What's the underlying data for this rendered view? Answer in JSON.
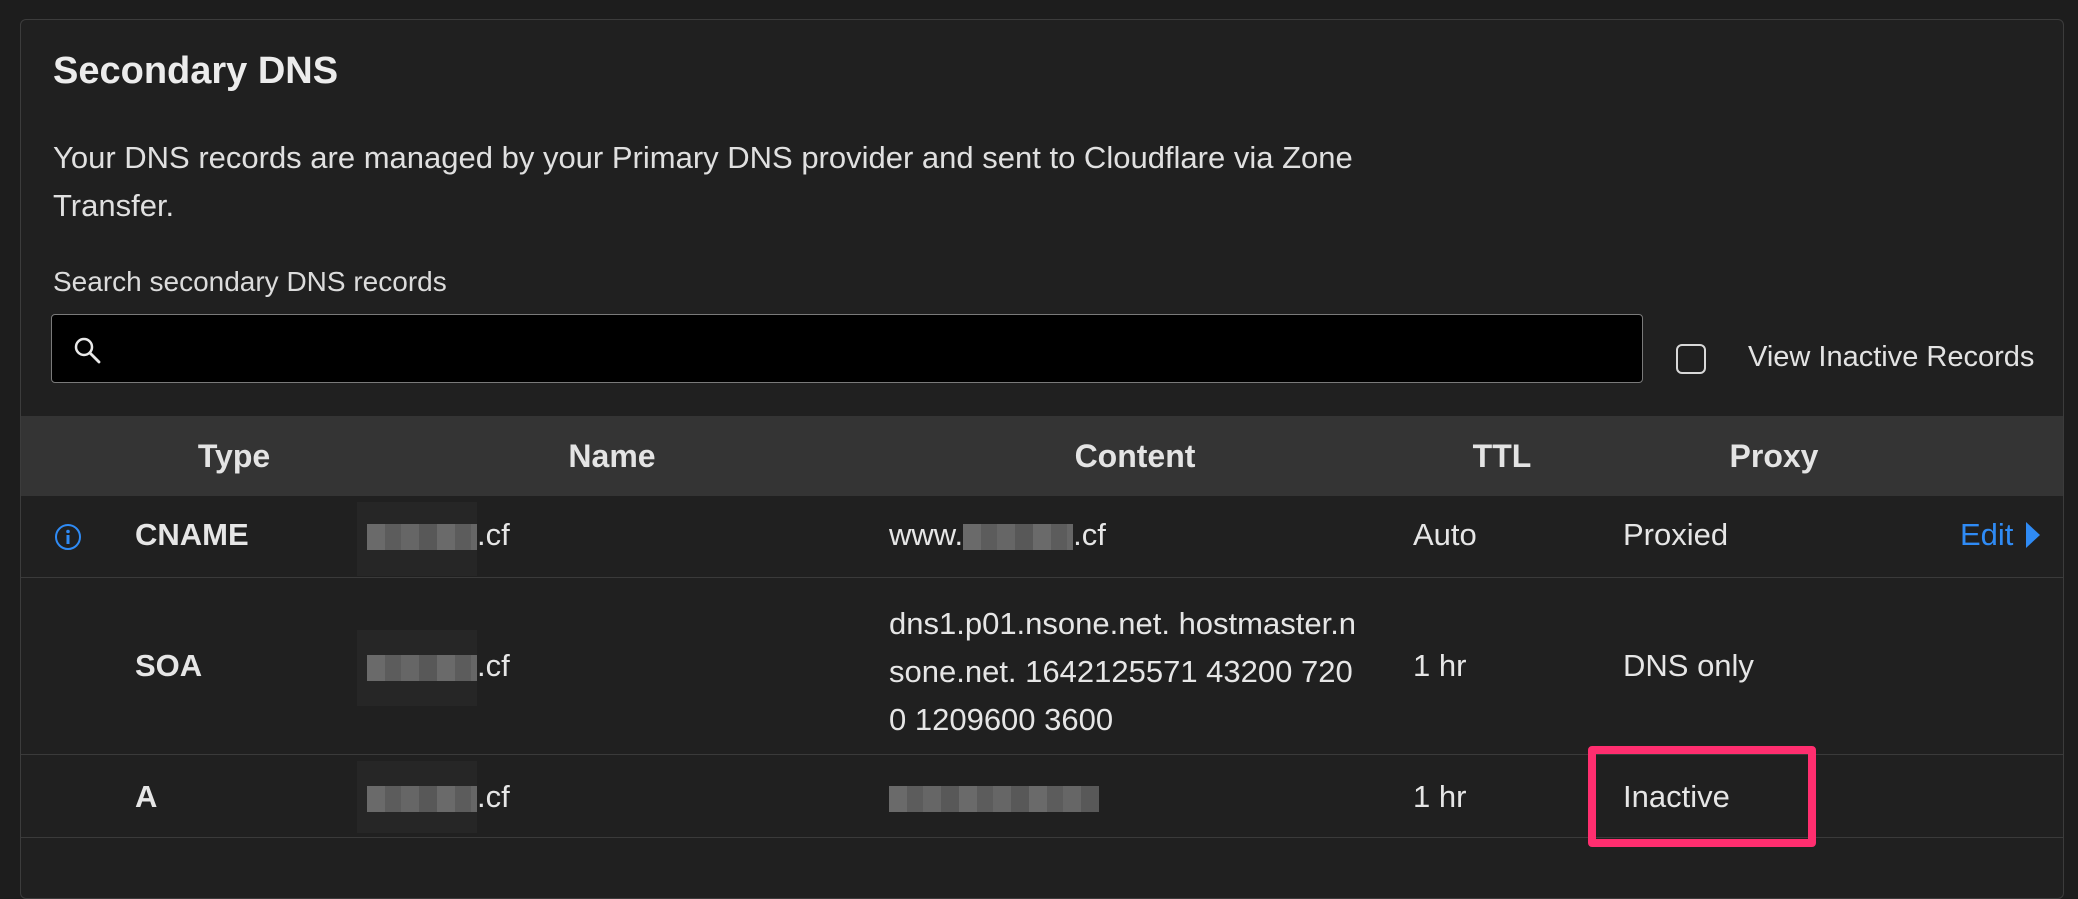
{
  "card": {
    "title": "Secondary DNS",
    "description": "Your DNS records are managed by your Primary DNS provider and sent to Cloudflare via Zone Transfer.",
    "search_label": "Search secondary DNS records",
    "search_placeholder": "",
    "view_inactive_label": "View Inactive Records",
    "view_inactive_checked": false
  },
  "table": {
    "headers": {
      "type": "Type",
      "name": "Name",
      "content": "Content",
      "ttl": "TTL",
      "proxy": "Proxy"
    },
    "rows": [
      {
        "type": "CNAME",
        "name_suffix": ".cf",
        "content_prefix": "www.",
        "content_suffix": ".cf",
        "ttl": "Auto",
        "proxy": "Proxied",
        "action": "Edit"
      },
      {
        "type": "SOA",
        "name_suffix": ".cf",
        "content_lines": [
          "dns1.p01.nsone.net. hostmaster.n",
          "sone.net. 1642125571 43200 720",
          "0 1209600 3600"
        ],
        "ttl": "1 hr",
        "proxy": "DNS only"
      },
      {
        "type": "A",
        "name_suffix": ".cf",
        "ttl": "1 hr",
        "proxy": "Inactive"
      }
    ]
  },
  "colors": {
    "accent": "#2f8bf5",
    "highlight": "#ff2e6f"
  }
}
